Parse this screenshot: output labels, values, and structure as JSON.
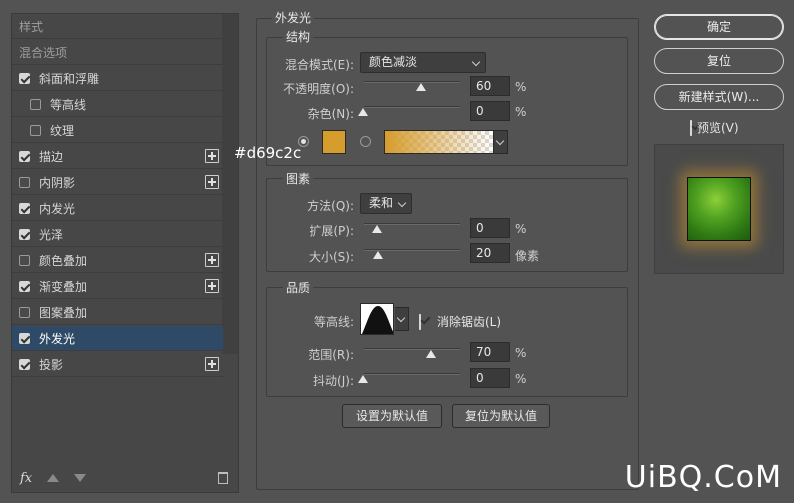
{
  "left_panel": {
    "items": [
      {
        "label": "样式",
        "checkbox": null,
        "plus": false,
        "header": true
      },
      {
        "label": "混合选项",
        "checkbox": null,
        "plus": false,
        "header": true
      },
      {
        "label": "斜面和浮雕",
        "checkbox": true,
        "plus": false
      },
      {
        "label": "等高线",
        "checkbox": false,
        "plus": false,
        "indent": true
      },
      {
        "label": "纹理",
        "checkbox": false,
        "plus": false,
        "indent": true
      },
      {
        "label": "描边",
        "checkbox": true,
        "plus": true
      },
      {
        "label": "内阴影",
        "checkbox": false,
        "plus": true
      },
      {
        "label": "内发光",
        "checkbox": true,
        "plus": false
      },
      {
        "label": "光泽",
        "checkbox": true,
        "plus": false
      },
      {
        "label": "颜色叠加",
        "checkbox": false,
        "plus": true
      },
      {
        "label": "渐变叠加",
        "checkbox": true,
        "plus": true
      },
      {
        "label": "图案叠加",
        "checkbox": false,
        "plus": false
      },
      {
        "label": "外发光",
        "checkbox": true,
        "plus": false,
        "selected": true
      },
      {
        "label": "投影",
        "checkbox": true,
        "plus": true
      }
    ],
    "footer": {
      "fx_label": "fx"
    }
  },
  "panel_title": "外发光",
  "structure": {
    "legend": "结构",
    "blend_mode_label": "混合模式(E):",
    "blend_mode_value": "颜色减淡",
    "opacity_label": "不透明度(O):",
    "opacity_value": "60",
    "opacity_percent": 60,
    "noise_label": "杂色(N):",
    "noise_value": "0",
    "noise_percent": 0,
    "percent_unit": "%",
    "color_hex": "#d69c2c",
    "color_label": "#d69c2c"
  },
  "elements": {
    "legend": "图素",
    "technique_label": "方法(Q):",
    "technique_value": "柔和",
    "spread_label": "扩展(P):",
    "spread_value": "0",
    "spread_percent": 0,
    "size_label": "大小(S):",
    "size_value": "20",
    "size_unit": "像素"
  },
  "quality": {
    "legend": "品质",
    "contour_label": "等高线:",
    "antialias_label": "消除锯齿(L)",
    "antialias_checked": true,
    "range_label": "范围(R):",
    "range_value": "70",
    "range_percent": 70,
    "jitter_label": "抖动(J):",
    "jitter_value": "0",
    "jitter_percent": 0
  },
  "buttons": {
    "make_default": "设置为默认值",
    "reset_default": "复位为默认值"
  },
  "right": {
    "ok": "确定",
    "reset": "复位",
    "new_style": "新建样式(W)...",
    "preview_label": "预览(V)",
    "preview_checked": true
  },
  "watermark": "UiBQ.CoM"
}
